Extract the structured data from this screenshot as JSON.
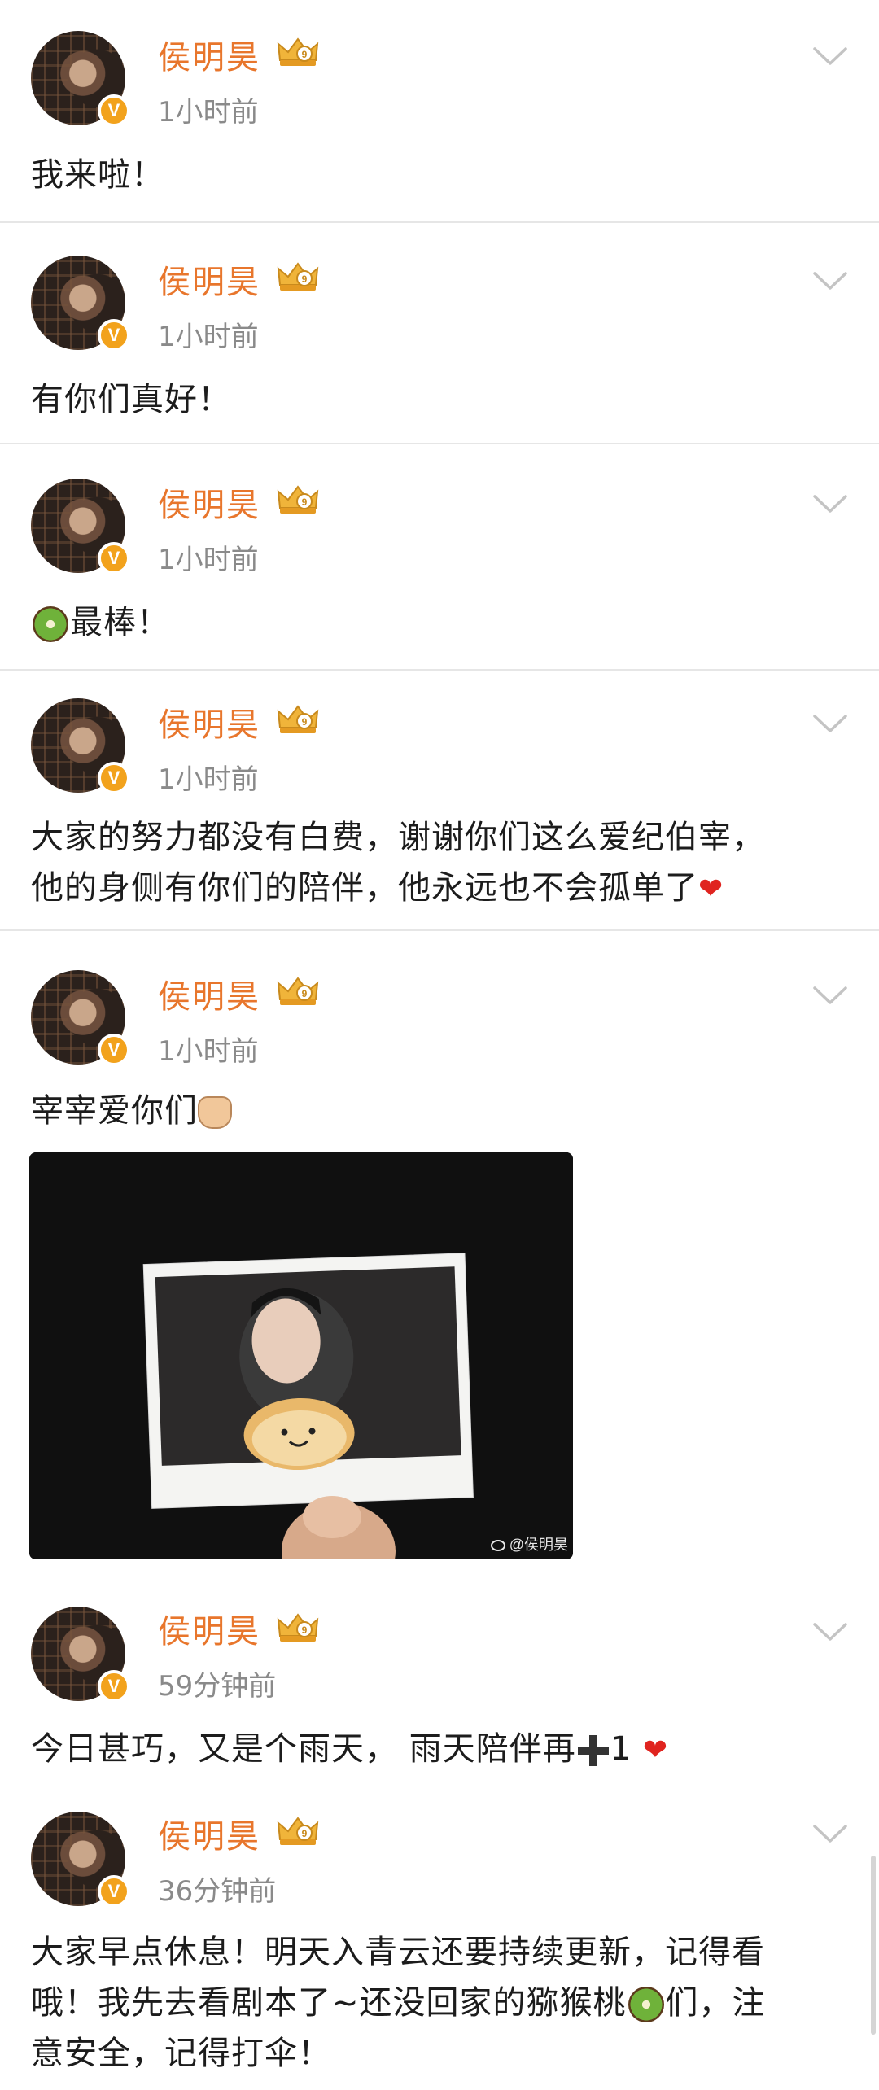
{
  "colors": {
    "name": "#e8762c",
    "time": "#8a8a8a",
    "badge": "#f2a21c",
    "heart": "#e0241f"
  },
  "posts": [
    {
      "name": "侯明昊",
      "time": "1小时前",
      "text": "我来啦！"
    },
    {
      "name": "侯明昊",
      "time": "1小时前",
      "text": "有你们真好！"
    },
    {
      "name": "侯明昊",
      "time": "1小时前",
      "text": "最棒！"
    },
    {
      "name": "侯明昊",
      "time": "1小时前",
      "line1": "大家的努力都没有白费，谢谢你们这么爱纪伯宰，",
      "line2": "他的身侧有你们的陪伴，他永远也不会孤单了"
    },
    {
      "name": "侯明昊",
      "time": "1小时前",
      "text": "宰宰爱你们",
      "watermark": "@侯明昊"
    },
    {
      "name": "侯明昊",
      "time": "59分钟前",
      "text_a": "今日甚巧，又是个雨天， 雨天陪伴再",
      "text_b": "1"
    },
    {
      "name": "侯明昊",
      "time": "36分钟前",
      "line1": "大家早点休息！明天入青云还要持续更新，记得看",
      "line2a": "哦！我先去看剧本了~还没回家的猕猴桃",
      "line2b": "们，注",
      "line3": "意安全，记得打伞！"
    }
  ],
  "icons": {
    "verified": "v-badge-icon",
    "crown": "crown-icon",
    "more": "chevron-down-icon",
    "weibo": "weibo-icon"
  }
}
